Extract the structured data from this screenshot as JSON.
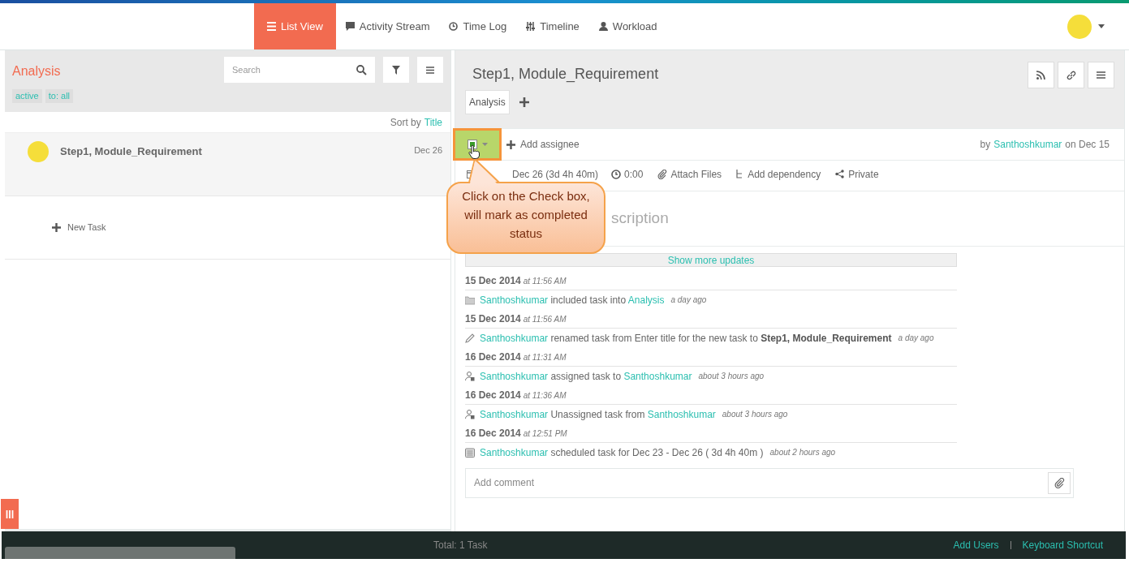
{
  "nav": {
    "tabs": [
      {
        "label": "List View",
        "selected": true
      },
      {
        "label": "Activity Stream",
        "selected": false
      },
      {
        "label": "Time Log",
        "selected": false
      },
      {
        "label": "Timeline",
        "selected": false
      },
      {
        "label": "Workload",
        "selected": false
      }
    ]
  },
  "list_panel": {
    "title": "Analysis",
    "search": {
      "placeholder": "Search"
    },
    "filters": [
      "active",
      "to: all"
    ],
    "sort_label": "Sort by",
    "sort_field": "Title",
    "tasks": [
      {
        "title": "Step1, Module_Requirement",
        "date": "Dec 26"
      }
    ],
    "new_task": "New Task"
  },
  "task": {
    "title": "Step1, Module_Requirement",
    "tags": [
      "Analysis"
    ],
    "add_assignee": "Add assignee",
    "by": "by",
    "author": "Santhoshkumar",
    "on": "on Dec 15",
    "schedule": "Dec 26 (3d 4h 40m)",
    "time": "0:00",
    "attach": "Attach Files",
    "dependency": "Add dependency",
    "privacy": "Private",
    "description_placeholder": "scription",
    "show_more": "Show more updates",
    "activity": [
      {
        "date": "15 Dec 2014",
        "time": "at 11:56 AM",
        "kind": "folder",
        "parts": [
          {
            "kind": "link",
            "text": "Santhoshkumar"
          },
          {
            "kind": "plain",
            "text": " included task into "
          },
          {
            "kind": "link",
            "text": "Analysis"
          }
        ],
        "ago": "a day ago"
      },
      {
        "date": "15 Dec 2014",
        "time": "at 11:56 AM",
        "kind": "rename",
        "parts": [
          {
            "kind": "link",
            "text": "Santhoshkumar"
          },
          {
            "kind": "plain",
            "text": " renamed task from Enter title for the new task to "
          },
          {
            "kind": "bold",
            "text": "Step1, Module_Requirement"
          }
        ],
        "ago": "a day ago"
      },
      {
        "date": "16 Dec 2014",
        "time": "at 11:31 AM",
        "kind": "assign",
        "parts": [
          {
            "kind": "link",
            "text": "Santhoshkumar"
          },
          {
            "kind": "plain",
            "text": " assigned task to "
          },
          {
            "kind": "link",
            "text": "Santhoshkumar"
          }
        ],
        "ago": "about 3 hours ago"
      },
      {
        "date": "16 Dec 2014",
        "time": "at 11:36 AM",
        "kind": "assign",
        "parts": [
          {
            "kind": "link",
            "text": "Santhoshkumar"
          },
          {
            "kind": "plain",
            "text": " Unassigned task from "
          },
          {
            "kind": "link",
            "text": "Santhoshkumar"
          }
        ],
        "ago": "about 3 hours ago"
      },
      {
        "date": "16 Dec 2014",
        "time": "at 12:51 PM",
        "kind": "schedule",
        "parts": [
          {
            "kind": "link",
            "text": "Santhoshkumar"
          },
          {
            "kind": "plain",
            "text": " scheduled task for Dec 23 - Dec 26 ( 3d 4h 40m )"
          }
        ],
        "ago": "about 2 hours ago"
      }
    ],
    "comment": {
      "placeholder": "Add comment"
    }
  },
  "callout": "Click on the Check box, will mark as completed status",
  "footer": {
    "total": "Total: 1 Task",
    "links": [
      "Add Users",
      "Keyboard Shortcut"
    ]
  }
}
